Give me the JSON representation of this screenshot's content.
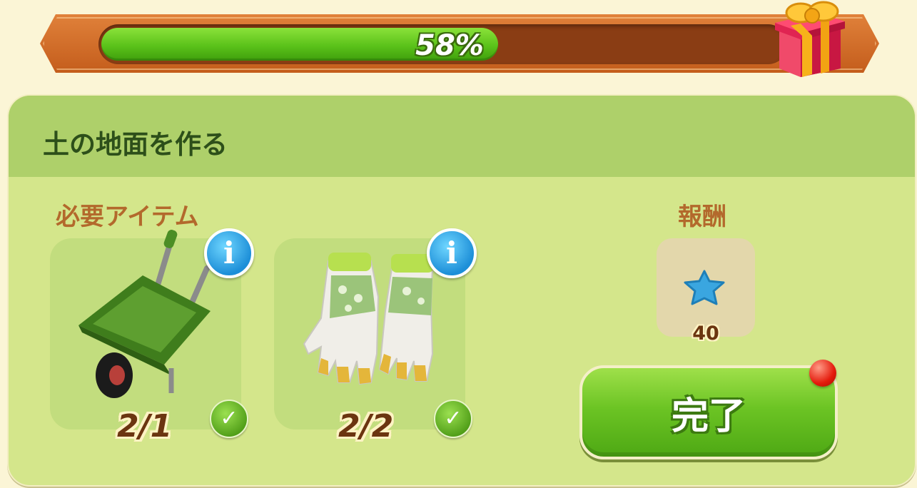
{
  "progress": {
    "value_percent": 58,
    "label": "58%"
  },
  "task": {
    "title": "土の地面を作る"
  },
  "required_items": {
    "heading": "必要アイテム",
    "items": [
      {
        "icon": "wheelbarrow-icon",
        "count": "2/1",
        "info_label": "i",
        "completed": true
      },
      {
        "icon": "gloves-icon",
        "count": "2/2",
        "info_label": "i",
        "completed": true
      }
    ]
  },
  "reward": {
    "heading": "報酬",
    "icon": "blue-star-icon",
    "amount": "40"
  },
  "actions": {
    "complete_label": "完了",
    "has_notification": true
  },
  "colors": {
    "progress_fill": "#5bc21a",
    "card_bg": "#d4e68b",
    "header_bg": "#aed06a",
    "accent_brown": "#b3692c",
    "button_green": "#6cc424",
    "notify_red": "#e41b0c"
  }
}
